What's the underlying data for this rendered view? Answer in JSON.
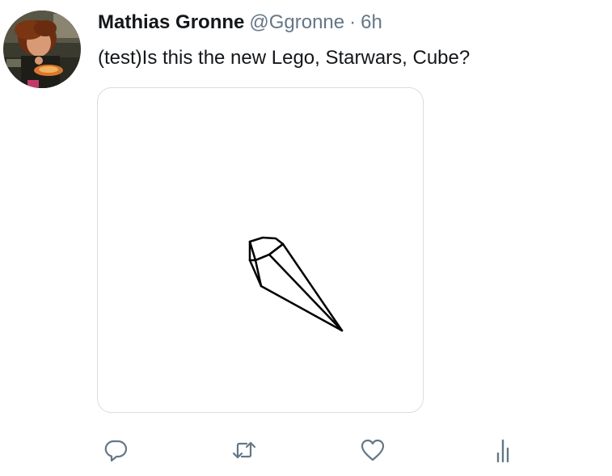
{
  "tweet": {
    "author_name": "Mathias Gronne",
    "handle": "@Ggronne",
    "separator": "·",
    "timestamp": "6h",
    "text": "(test)Is this the new Lego, Starwars, Cube?"
  },
  "avatar": {
    "alt": "Mathias Gronne profile photo"
  },
  "media": {
    "alt": "Line drawing of a crystal-like polyhedron"
  },
  "actions": [
    {
      "name": "reply",
      "icon": "reply-icon"
    },
    {
      "name": "retweet",
      "icon": "retweet-icon"
    },
    {
      "name": "like",
      "icon": "heart-icon"
    },
    {
      "name": "analytics",
      "icon": "analytics-icon"
    }
  ],
  "colors": {
    "text_primary": "#14171a",
    "text_secondary": "#657786",
    "border": "#d9dde1"
  }
}
